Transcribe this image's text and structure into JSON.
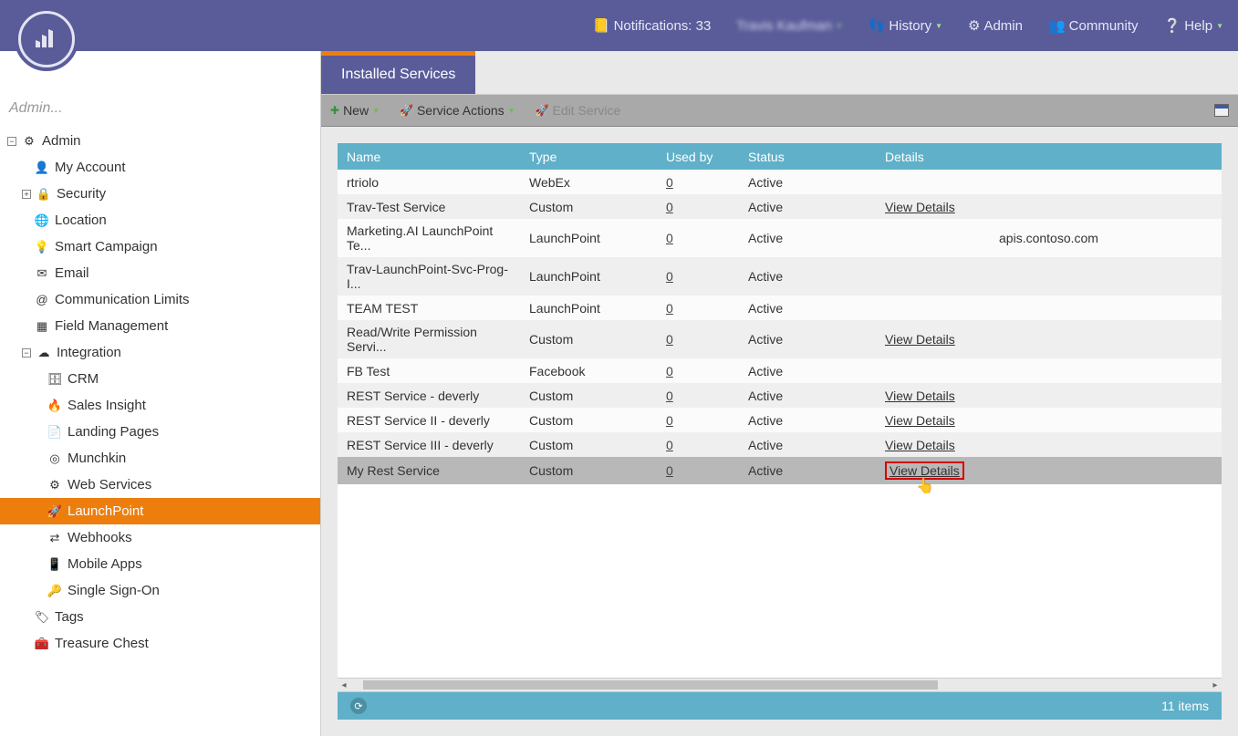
{
  "top": {
    "notifications_label": "Notifications: 33",
    "user_name": "Travis Kaufman",
    "history": "History",
    "admin": "Admin",
    "community": "Community",
    "help": "Help"
  },
  "search_placeholder": "Admin...",
  "tree": {
    "root": "Admin",
    "my_account": "My Account",
    "security": "Security",
    "location": "Location",
    "smart_campaign": "Smart Campaign",
    "email": "Email",
    "comm_limits": "Communication Limits",
    "field_mgmt": "Field Management",
    "integration": "Integration",
    "crm": "CRM",
    "sales_insight": "Sales Insight",
    "landing_pages": "Landing Pages",
    "munchkin": "Munchkin",
    "web_services": "Web Services",
    "launchpoint": "LaunchPoint",
    "webhooks": "Webhooks",
    "mobile_apps": "Mobile Apps",
    "sso": "Single Sign-On",
    "tags": "Tags",
    "treasure_chest": "Treasure Chest"
  },
  "tab_title": "Installed Services",
  "toolbar": {
    "new": "New",
    "service_actions": "Service Actions",
    "edit_service": "Edit Service"
  },
  "columns": {
    "name": "Name",
    "type": "Type",
    "used_by": "Used by",
    "status": "Status",
    "details": "Details"
  },
  "view_details_label": "View Details",
  "rows": [
    {
      "name": "rtriolo",
      "type": "WebEx",
      "used_by": "0",
      "status": "Active",
      "details": ""
    },
    {
      "name": "Trav-Test Service",
      "type": "Custom",
      "used_by": "0",
      "status": "Active",
      "details": "View Details"
    },
    {
      "name": "Marketing.AI LaunchPoint Te...",
      "type": "LaunchPoint",
      "used_by": "0",
      "status": "Active",
      "details": "apis.contoso.com"
    },
    {
      "name": "Trav-LaunchPoint-Svc-Prog-I...",
      "type": "LaunchPoint",
      "used_by": "0",
      "status": "Active",
      "details": ""
    },
    {
      "name": "TEAM TEST",
      "type": "LaunchPoint",
      "used_by": "0",
      "status": "Active",
      "details": ""
    },
    {
      "name": "Read/Write Permission Servi...",
      "type": "Custom",
      "used_by": "0",
      "status": "Active",
      "details": "View Details"
    },
    {
      "name": "FB Test",
      "type": "Facebook",
      "used_by": "0",
      "status": "Active",
      "details": ""
    },
    {
      "name": "REST Service - deverly",
      "type": "Custom",
      "used_by": "0",
      "status": "Active",
      "details": "View Details"
    },
    {
      "name": "REST Service II - deverly",
      "type": "Custom",
      "used_by": "0",
      "status": "Active",
      "details": "View Details"
    },
    {
      "name": "REST Service III - deverly",
      "type": "Custom",
      "used_by": "0",
      "status": "Active",
      "details": "View Details"
    },
    {
      "name": "My Rest Service",
      "type": "Custom",
      "used_by": "0",
      "status": "Active",
      "details": "View Details",
      "selected": true,
      "highlight": true
    }
  ],
  "status_count": "11 items"
}
